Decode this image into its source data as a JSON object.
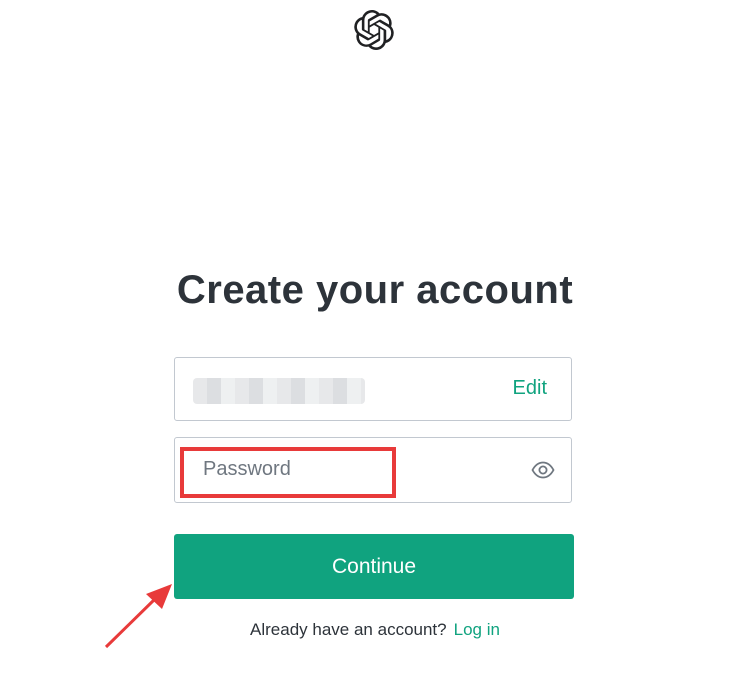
{
  "logo_icon": "openai-logo-icon",
  "title": "Create your account",
  "email_field": {
    "edit_label": "Edit"
  },
  "password_field": {
    "placeholder": "Password",
    "toggle_icon": "eye-icon"
  },
  "continue_button": "Continue",
  "footer": {
    "prompt": "Already have an account?",
    "login_link": "Log in"
  },
  "annotation": {
    "highlight_color": "#e83a3a",
    "arrow_color": "#e83a3a"
  },
  "colors": {
    "accent": "#10a37f",
    "text": "#2d333a",
    "border": "#c2c8d0"
  }
}
